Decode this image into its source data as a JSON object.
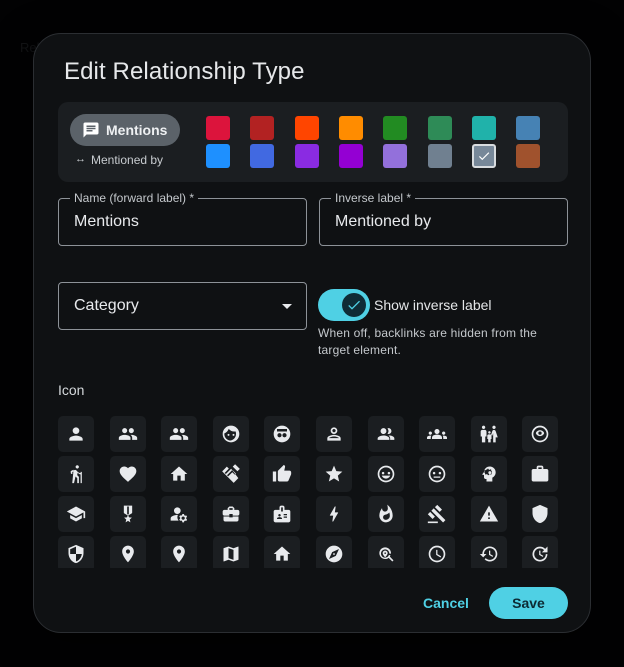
{
  "dialog": {
    "title": "Edit Relationship Type",
    "preview": {
      "chip_label": "Mentions",
      "inverse_arrow": "↔",
      "inverse_label": "Mentioned by"
    },
    "colors": [
      "#dc143c",
      "#b22222",
      "#ff4500",
      "#ff8c00",
      "#228b22",
      "#2e8b57",
      "#20b2aa",
      "#4682b4",
      "#1e90ff",
      "#4169e1",
      "#8a2be2",
      "#9400d3",
      "#9370db",
      "#708090",
      "#778899",
      "#a0522d"
    ],
    "selected_color_index": 14,
    "name_field": {
      "label": "Name (forward label) *",
      "value": "Mentions"
    },
    "inverse_field": {
      "label": "Inverse label *",
      "value": "Mentioned by"
    },
    "category_field": {
      "placeholder": "Category"
    },
    "show_inverse": {
      "label": "Show inverse label",
      "checked": true,
      "helper": "When off, backlinks are hidden from the target element."
    },
    "icon_section": {
      "heading": "Icon"
    },
    "icons": [
      "person",
      "people",
      "group",
      "face",
      "face-retouch",
      "person-outline",
      "people-outline",
      "groups",
      "family",
      "mood-eye",
      "hiking",
      "heart",
      "home",
      "handshake",
      "thumb-up",
      "star",
      "smile",
      "neutral",
      "psychology",
      "work",
      "school",
      "military",
      "manage-accounts",
      "business-center",
      "badge",
      "bolt",
      "fire",
      "gavel",
      "warning",
      "shield",
      "security",
      "place",
      "location",
      "map",
      "house",
      "explore",
      "search-location",
      "schedule",
      "history",
      "update"
    ],
    "cancel_label": "Cancel",
    "save_label": "Save"
  }
}
